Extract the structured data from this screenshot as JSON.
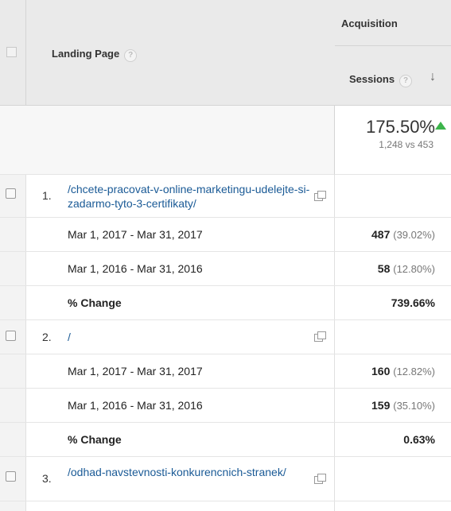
{
  "header": {
    "landing_page_label": "Landing Page",
    "acquisition_label": "Acquisition",
    "sessions_label": "Sessions",
    "help_glyph": "?",
    "sort_glyph": "↓"
  },
  "summary": {
    "percent_change": "175.50%",
    "comparison": "1,248 vs 453",
    "trend": "up",
    "trend_color": "#3cb44b"
  },
  "rows": [
    {
      "index": "1.",
      "page": "/chcete-pracovat-v-online-marketingu-udelejte-si-zadarmo-tyto-3-certifikaty/",
      "periods": [
        {
          "range": "Mar 1, 2017 - Mar 31, 2017",
          "sessions": "487",
          "share": "(39.02%)"
        },
        {
          "range": "Mar 1, 2016 - Mar 31, 2016",
          "sessions": "58",
          "share": "(12.80%)"
        }
      ],
      "change_label": "% Change",
      "change_value": "739.66%"
    },
    {
      "index": "2.",
      "page": "/",
      "periods": [
        {
          "range": "Mar 1, 2017 - Mar 31, 2017",
          "sessions": "160",
          "share": "(12.82%)"
        },
        {
          "range": "Mar 1, 2016 - Mar 31, 2016",
          "sessions": "159",
          "share": "(35.10%)"
        }
      ],
      "change_label": "% Change",
      "change_value": "0.63%"
    },
    {
      "index": "3.",
      "page": "/odhad-navstevnosti-konkurencnich-stranek/"
    }
  ],
  "colors": {
    "link": "#1a5a96",
    "header_bg": "#eaeaea",
    "row_alt_bg": "#f3f3f3"
  }
}
